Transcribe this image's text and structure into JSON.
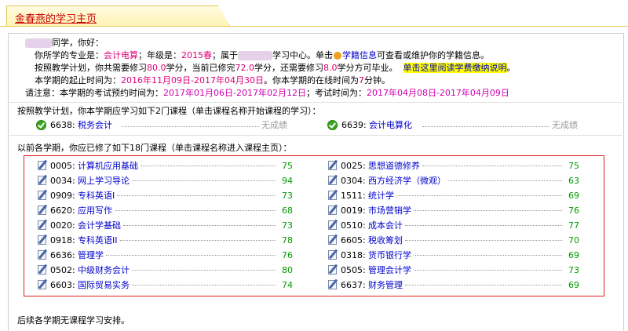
{
  "tab": {
    "title": "金春燕的学习主页"
  },
  "intro": {
    "greeting_suffix": "同学，你好：",
    "major_prefix": "你所学的专业是：",
    "major": "会计电算",
    "grade_prefix": "；年级是：",
    "grade": "2015春",
    "belong_prefix": "；属于",
    "center_suffix": "学习中心。单击",
    "status_link": "学籍信息",
    "status_suffix": "可查看或维护你的学籍信息。",
    "plan_prefix": "按照教学计划，你共需要修习",
    "total_credits": "80.0",
    "plan_mid1": "学分，当前已修完",
    "done_credits": "72.0",
    "plan_mid2": "学分，还需要修习",
    "remain_credits": "8.0",
    "plan_suffix": "学分方可毕业。",
    "fee_link": "单击这里阅读学费缴纳说明",
    "fee_suffix": "。",
    "term_prefix": "本学期的起止时间为：",
    "term_range": "2016年11月09日-2017年04月30日",
    "term_mid": "。你本学期的在线时间为",
    "online_minutes": "7",
    "term_suffix": "分钟。",
    "exam_prefix": "请注意：本学期的考试预约时间为：",
    "exam_book_range": "2017年01月06日-2017年02月12日",
    "exam_mid": "；考试时间为：",
    "exam_range": "2017年04月08日-2017年04月09日"
  },
  "current": {
    "heading": "按照教学计划，你本学期应学习如下2门课程（单击课程名称开始课程的学习）：",
    "courses": [
      {
        "code": "6638:",
        "name": "税务会计",
        "status": "无成绩"
      },
      {
        "code": "6639:",
        "name": "会计电算化",
        "status": "无成绩"
      }
    ]
  },
  "past": {
    "heading": "以前各学期，你应已修了如下18门课程（单击课程名称进入课程主页）：",
    "left": [
      {
        "code": "0005:",
        "name": "计算机应用基础",
        "score": "75"
      },
      {
        "code": "0034:",
        "name": "网上学习导论",
        "score": "94"
      },
      {
        "code": "0909:",
        "name": "专科英语I",
        "score": "73"
      },
      {
        "code": "6620:",
        "name": "应用写作",
        "score": "68"
      },
      {
        "code": "0020:",
        "name": "会计学基础",
        "score": "73"
      },
      {
        "code": "0918:",
        "name": "专科英语II",
        "score": "78"
      },
      {
        "code": "6636:",
        "name": "管理学",
        "score": "76"
      },
      {
        "code": "0502:",
        "name": "中级财务会计",
        "score": "80"
      },
      {
        "code": "6603:",
        "name": "国际贸易实务",
        "score": "74"
      }
    ],
    "right": [
      {
        "code": "0025:",
        "name": "思想道德修养",
        "score": "75"
      },
      {
        "code": "0304:",
        "name": "西方经济学（微观）",
        "score": "63"
      },
      {
        "code": "1511:",
        "name": "统计学",
        "score": "69"
      },
      {
        "code": "0019:",
        "name": "市场营销学",
        "score": "76"
      },
      {
        "code": "0510:",
        "name": "成本会计",
        "score": "77"
      },
      {
        "code": "6605:",
        "name": "税收筹划",
        "score": "70"
      },
      {
        "code": "0318:",
        "name": "货币银行学",
        "score": "69"
      },
      {
        "code": "0505:",
        "name": "管理会计学",
        "score": "73"
      },
      {
        "code": "6637:",
        "name": "财务管理",
        "score": "69"
      }
    ]
  },
  "footer": {
    "text": "后续各学期无课程学习安排。"
  }
}
